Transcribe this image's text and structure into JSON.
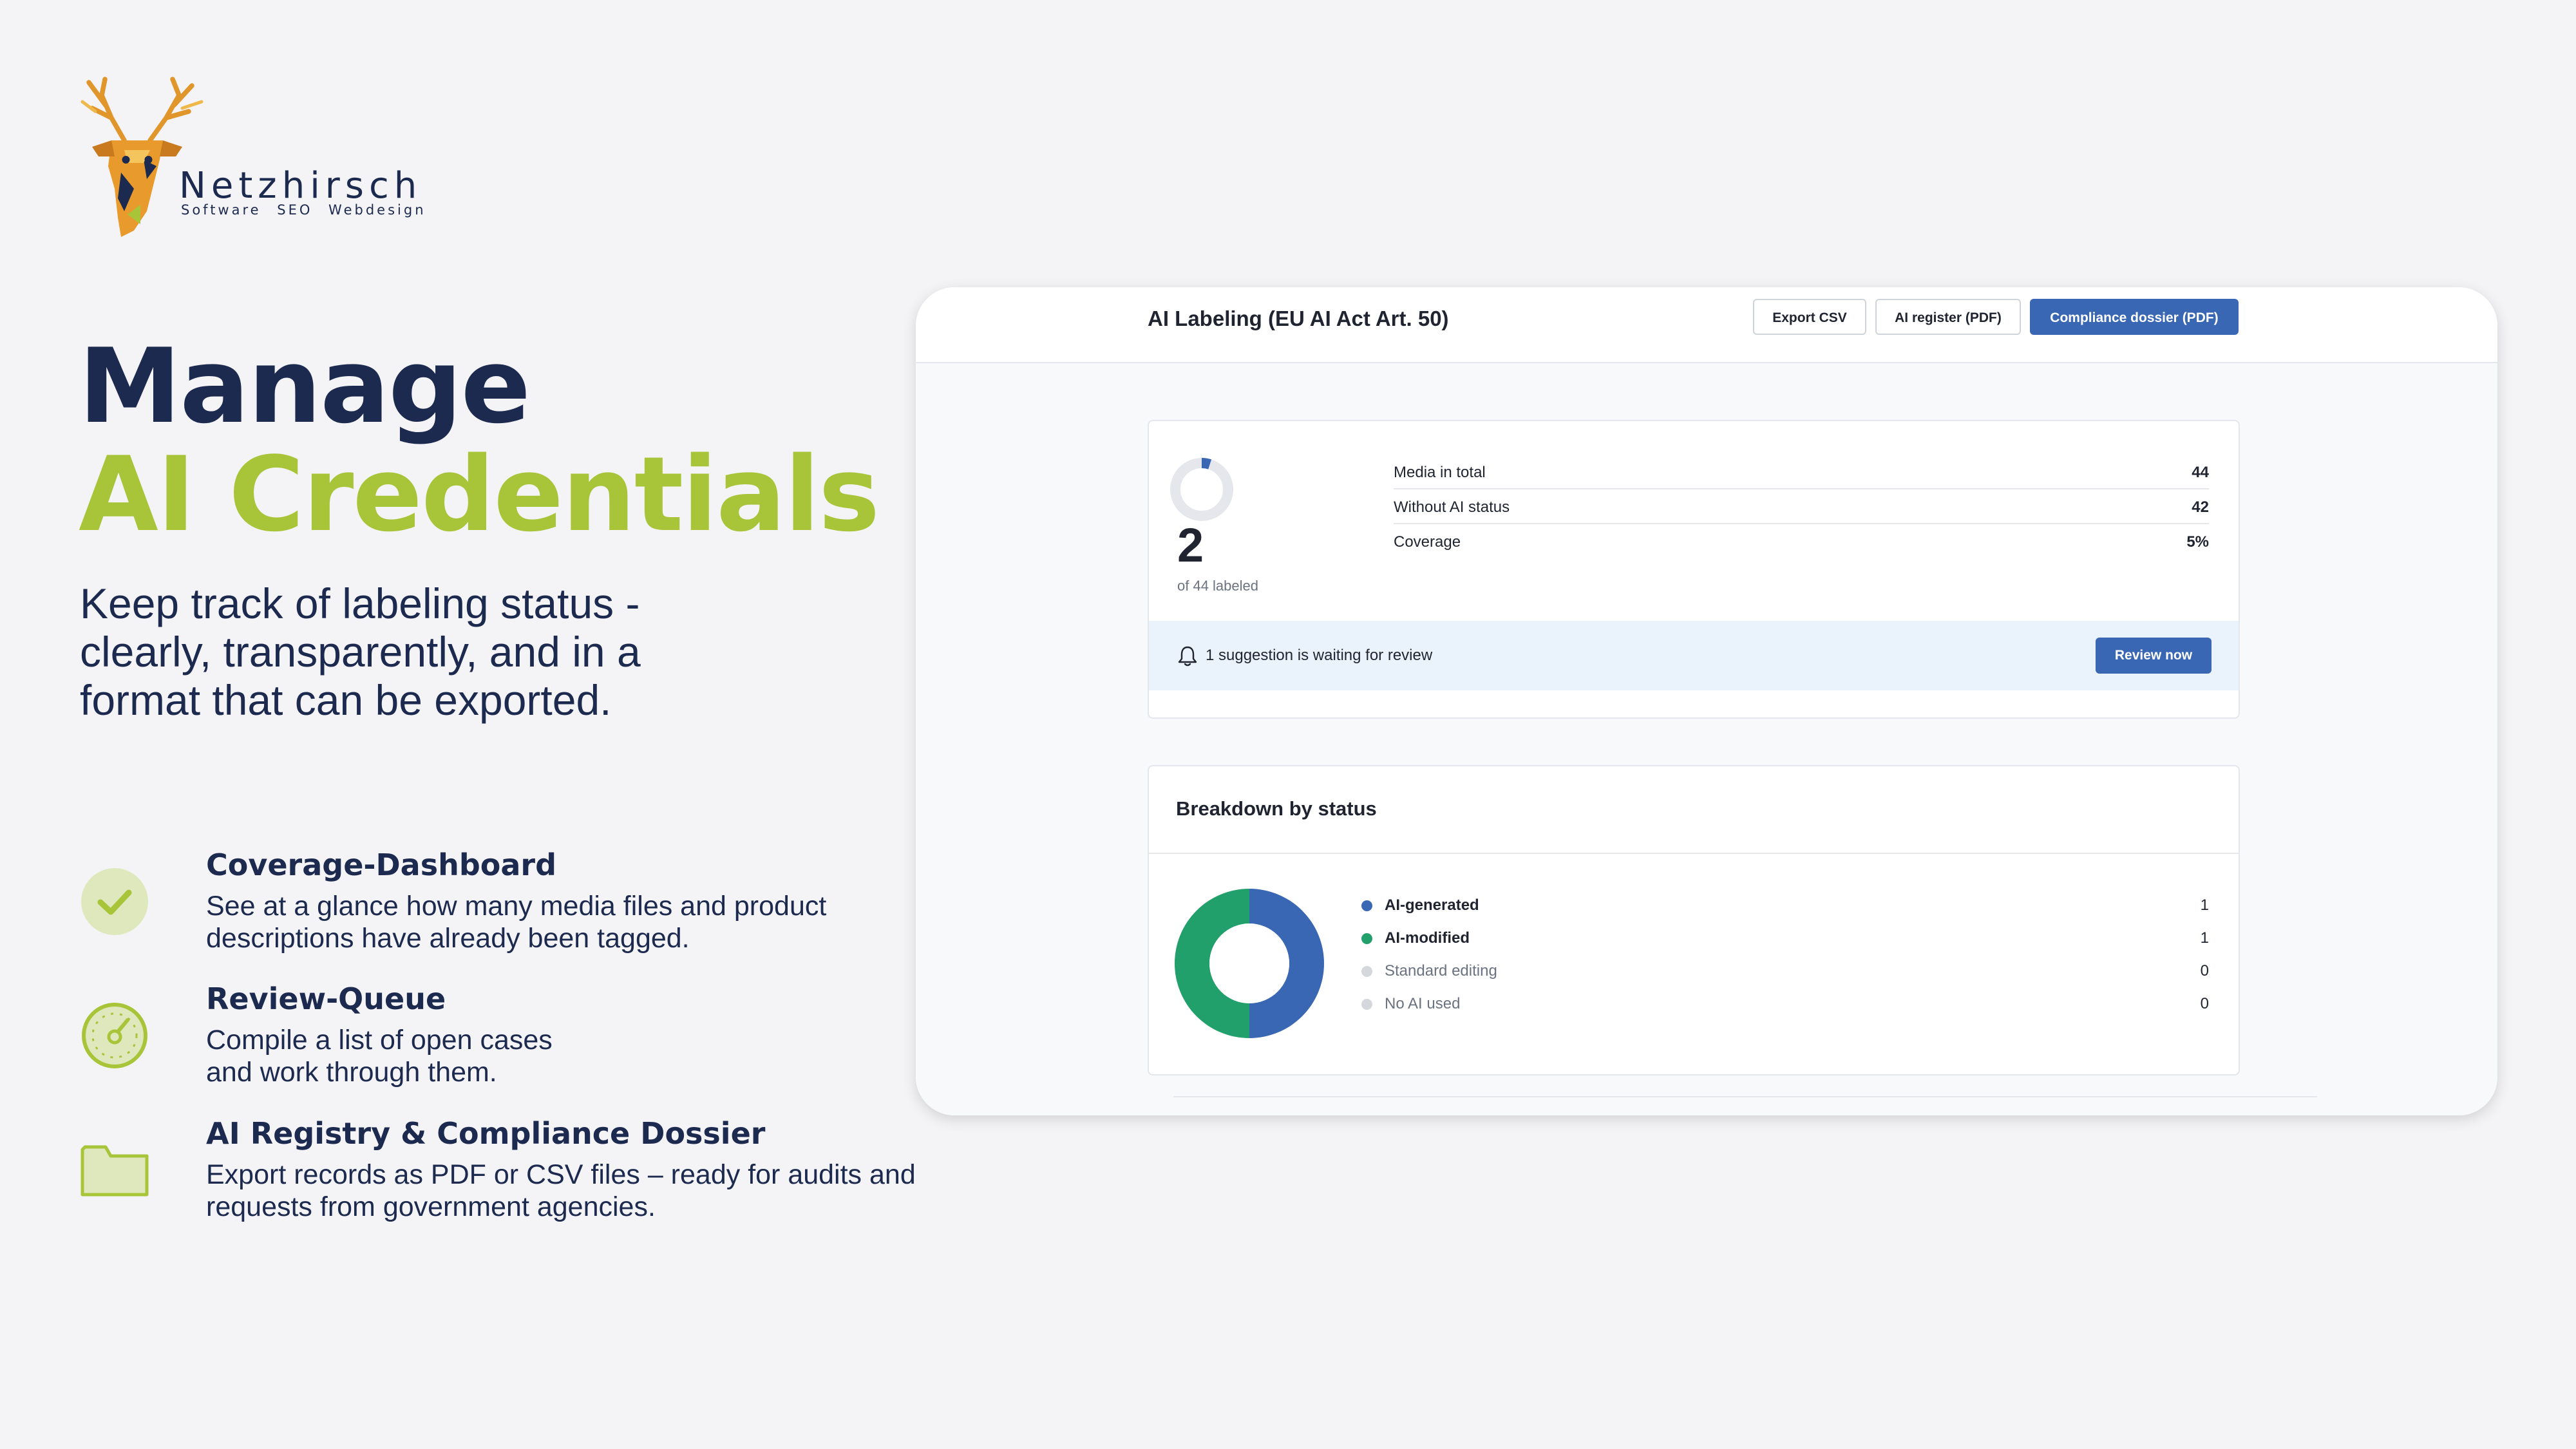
{
  "brand": {
    "name": "Netzhirsch",
    "tagline": "Software SEO Webdesign"
  },
  "hero": {
    "title_line1": "Manage",
    "title_line2": "AI Credentials",
    "subtitle": "Keep track of labeling status - clearly, transparently, and in a format that can be exported."
  },
  "features": [
    {
      "icon": "check-circle-icon",
      "title": "Coverage-Dashboard",
      "description": "See at a glance how many media files and product descriptions have already been tagged."
    },
    {
      "icon": "gauge-icon",
      "title": "Review-Queue",
      "description": "Compile a list of open cases and work through them."
    },
    {
      "icon": "folder-icon",
      "title": "AI Registry & Compliance Dossier",
      "description": "Export records as PDF or CSV files – ready for audits and requests from government agencies."
    }
  ],
  "app": {
    "title": "AI Labeling (EU AI Act Art. 50)",
    "buttons": {
      "export_csv": "Export CSV",
      "ai_register": "AI register (PDF)",
      "compliance_dossier": "Compliance dossier (PDF)"
    },
    "summary": {
      "labeled_count": "2",
      "of_label": "of 44 labeled",
      "coverage_fraction": 0.05,
      "stats": [
        {
          "label": "Media in total",
          "value": "44"
        },
        {
          "label": "Without AI status",
          "value": "42"
        },
        {
          "label": "Coverage",
          "value": "5%"
        }
      ],
      "notice": "1 suggestion is waiting for review",
      "review_button": "Review now"
    },
    "breakdown": {
      "title": "Breakdown by status",
      "items": [
        {
          "label": "AI-generated",
          "value": "1",
          "count": 1,
          "color": "#3a67b3",
          "strong": true
        },
        {
          "label": "AI-modified",
          "value": "1",
          "count": 1,
          "color": "#22a06b",
          "strong": true
        },
        {
          "label": "Standard editing",
          "value": "0",
          "count": 0,
          "color": "#d4d7dc",
          "strong": false
        },
        {
          "label": "No AI used",
          "value": "0",
          "count": 0,
          "color": "#d4d7dc",
          "strong": false
        }
      ]
    }
  },
  "colors": {
    "navy": "#1d2a4f",
    "lime": "#a8c53a",
    "primary": "#3a67b3",
    "green": "#22a06b",
    "notice_bg": "#eaf2fb"
  }
}
